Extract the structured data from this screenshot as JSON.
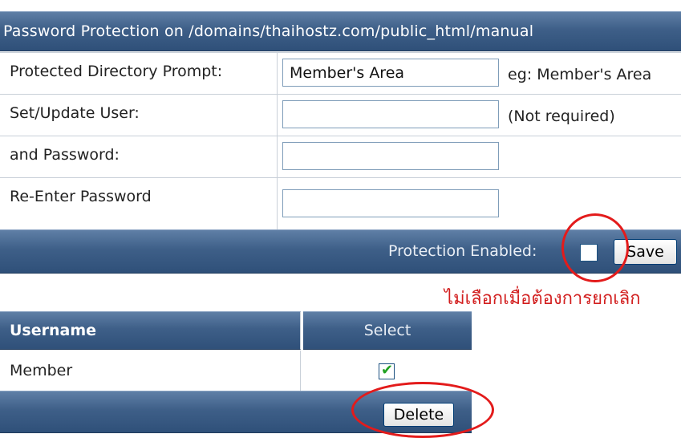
{
  "header": {
    "title": "Password Protection on /domains/thaihostz.com/public_html/manual"
  },
  "form": {
    "rows": [
      {
        "label": "Protected Directory Prompt:",
        "value": "Member's Area",
        "hint": "eg: Member's Area"
      },
      {
        "label": "Set/Update User:",
        "value": "",
        "hint": "(Not required)"
      },
      {
        "label": "and Password:",
        "value": "",
        "hint": ""
      },
      {
        "label": "Re-Enter Password",
        "value": "",
        "hint": ""
      }
    ]
  },
  "save_bar": {
    "protection_label": "Protection Enabled:",
    "save_label": "Save",
    "protection_checked": false
  },
  "annotation": {
    "note": "ไม่เลือกเมื่อต้องการยกเลิก",
    "color": "#e31b1b"
  },
  "users_table": {
    "headers": {
      "username": "Username",
      "select": "Select"
    },
    "rows": [
      {
        "username": "Member",
        "selected": true
      }
    ],
    "delete_label": "Delete",
    "check_glyph": "✔"
  },
  "colors": {
    "bar": "#3e5f88",
    "field_border": "#7f9db9"
  }
}
